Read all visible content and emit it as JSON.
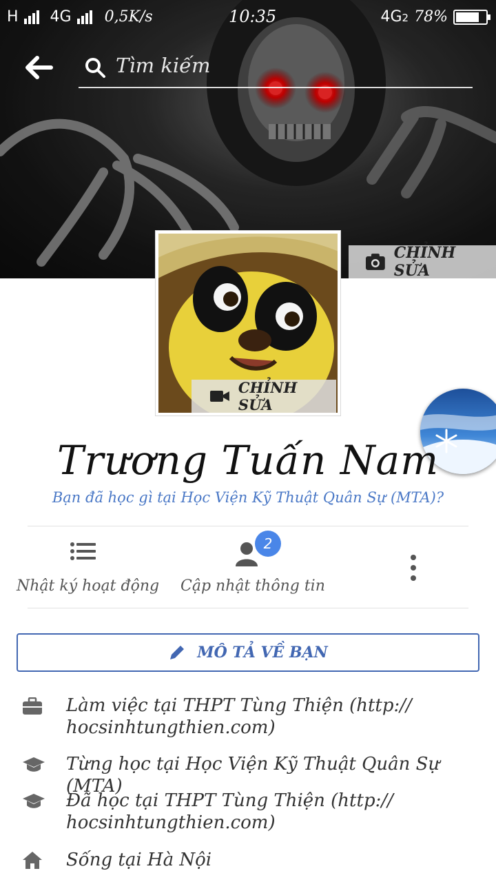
{
  "status_bar": {
    "network1": "H",
    "network2": "4G",
    "speed": "0,5K/s",
    "time": "10:35",
    "network3": "4G",
    "sim_index": "2",
    "battery": "78%",
    "battery_level": 0.78
  },
  "search": {
    "placeholder": "Tìm kiếm"
  },
  "cover": {
    "edit_label": "CHỈNH SỬA"
  },
  "profile_picture": {
    "edit_label": "CHỈNH SỬA"
  },
  "profile": {
    "name": "Trương Tuấn Nam",
    "prompt": "Bạn đã học gì tại Học Viện Kỹ Thuật Quân Sự (MTA)?"
  },
  "actions": {
    "activity_log": "Nhật ký hoạt động",
    "update_info": "Cập nhật thông tin",
    "update_badge": "2"
  },
  "describe_button": "MÔ TẢ VỀ BẠN",
  "intro": [
    {
      "icon": "briefcase-icon",
      "text": "Làm việc tại THPT Tùng Thiện (http:// hocsinhtungthien.com)"
    },
    {
      "icon": "graduation-cap-icon",
      "text": "Từng học tại Học Viện Kỹ Thuật Quân Sự (MTA)"
    },
    {
      "icon": "graduation-cap-icon",
      "text": "Đã học tại THPT Tùng Thiện (http:// hocsinhtungthien.com)"
    },
    {
      "icon": "home-icon",
      "text": "Sống tại Hà Nội"
    }
  ],
  "colors": {
    "accent": "#4267b2",
    "link": "#4a78c6",
    "badge": "#4a86e8"
  }
}
